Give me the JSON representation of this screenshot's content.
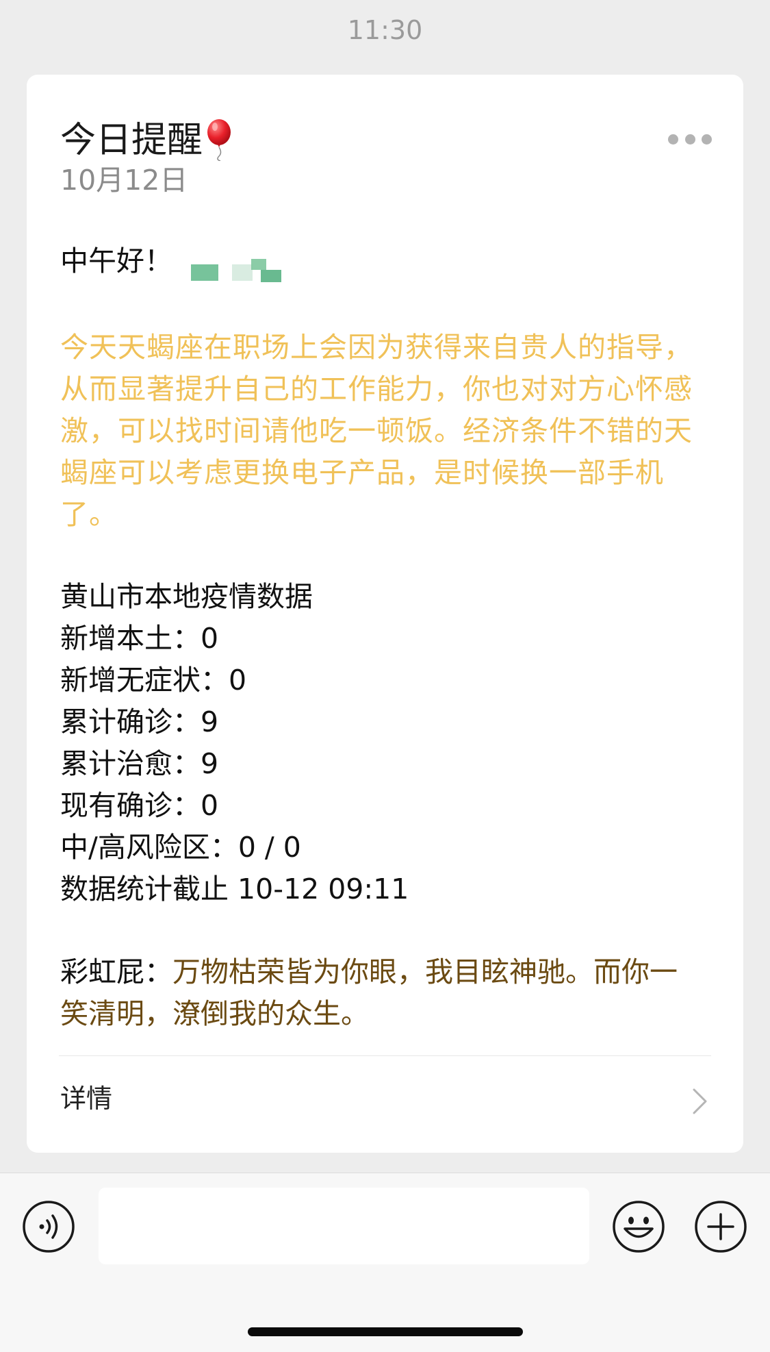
{
  "status_bar": {
    "time": "11:30"
  },
  "card": {
    "title": "今日提醒",
    "date": "10月12日",
    "greeting": "中午好！",
    "horoscope": "今天天蝎座在职场上会因为获得来自贵人的指导，从而显著提升自己的工作能力，你也对对方心怀感激，可以找时间请他吃一顿饭。经济条件不错的天蝎座可以考虑更换电子产品，是时候换一部手机了。",
    "stats": {
      "heading": "黄山市本地疫情数据",
      "lines": [
        "新增本土：0",
        "新增无症状：0",
        "累计确诊：9",
        "累计治愈：9",
        "现有确诊：0",
        "中/高风险区：0 / 0",
        "数据统计截止 10-12 09:11"
      ]
    },
    "rainbow": {
      "label": "彩虹屁：",
      "text": "万物枯荣皆为你眼，我目眩神驰。而你一笑清明，潦倒我的众生。"
    },
    "detail_label": "详情"
  },
  "input_bar": {
    "placeholder": ""
  },
  "icons": {
    "title_emoji": "balloon-icon",
    "more": "more-icon",
    "detail_arrow": "chevron-right-icon",
    "voice": "voice-icon",
    "emoji": "emoji-icon",
    "plus": "plus-icon"
  },
  "colors": {
    "horoscope_text": "#f0c158",
    "rainbow_text": "#6b4a12",
    "background": "#ededed",
    "card": "#ffffff"
  }
}
